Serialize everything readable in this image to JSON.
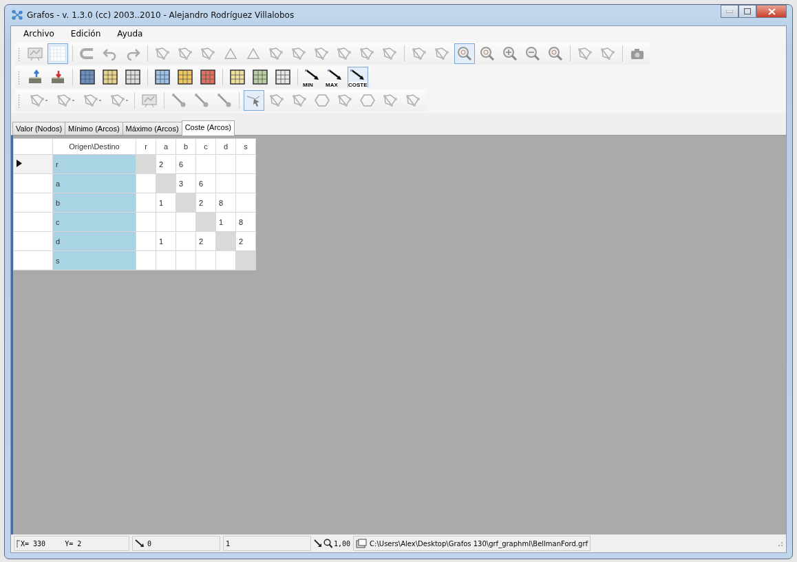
{
  "window": {
    "title": "Grafos - v. 1.3.0  (cc) 2003..2010 - Alejandro Rodríguez Villalobos"
  },
  "menu": [
    "Archivo",
    "Edición",
    "Ayuda"
  ],
  "toolbars": [
    {
      "items": [
        {
          "kind": "board",
          "selected": false
        },
        {
          "kind": "grid",
          "selected": true
        },
        {
          "kind": "separator"
        },
        {
          "kind": "magnet",
          "selected": false
        },
        {
          "kind": "undo",
          "selected": false
        },
        {
          "kind": "redo",
          "selected": false
        },
        {
          "kind": "separator"
        },
        {
          "kind": "graph",
          "selected": false
        },
        {
          "kind": "graph",
          "selected": false
        },
        {
          "kind": "graph",
          "selected": false
        },
        {
          "kind": "triangle",
          "selected": false
        },
        {
          "kind": "triangle",
          "selected": false
        },
        {
          "kind": "graph",
          "selected": false
        },
        {
          "kind": "graph",
          "selected": false
        },
        {
          "kind": "graph",
          "selected": false
        },
        {
          "kind": "graph",
          "selected": false
        },
        {
          "kind": "graph",
          "selected": false
        },
        {
          "kind": "graph",
          "selected": false
        },
        {
          "kind": "separator"
        },
        {
          "kind": "graph",
          "selected": false
        },
        {
          "kind": "graph",
          "selected": false
        },
        {
          "kind": "zoom",
          "selected": true
        },
        {
          "kind": "zoom",
          "selected": false
        },
        {
          "kind": "zoom-in",
          "selected": false
        },
        {
          "kind": "zoom-out",
          "selected": false
        },
        {
          "kind": "zoom",
          "selected": false
        },
        {
          "kind": "separator"
        },
        {
          "kind": "graph",
          "selected": false
        },
        {
          "kind": "graph",
          "selected": false
        },
        {
          "kind": "separator"
        },
        {
          "kind": "camera",
          "selected": false
        }
      ]
    },
    {
      "items": [
        {
          "kind": "tray-up",
          "selected": false
        },
        {
          "kind": "tray-down",
          "selected": false
        },
        {
          "kind": "separator"
        },
        {
          "kind": "table",
          "color": "#6a8fc0",
          "selected": false
        },
        {
          "kind": "table",
          "color": "#e8d48a",
          "selected": false
        },
        {
          "kind": "table",
          "color": "#dcdcdc",
          "selected": false
        },
        {
          "kind": "separator"
        },
        {
          "kind": "table",
          "color": "#9cc2e8",
          "selected": false
        },
        {
          "kind": "table",
          "color": "#f0c860",
          "selected": false
        },
        {
          "kind": "table",
          "color": "#e07060",
          "selected": false
        },
        {
          "kind": "separator"
        },
        {
          "kind": "table",
          "color": "#f0e0a0",
          "selected": false
        },
        {
          "kind": "table",
          "color": "#b8d0a0",
          "selected": false
        },
        {
          "kind": "table",
          "color": "#e8e8e8",
          "selected": false
        },
        {
          "kind": "separator"
        },
        {
          "kind": "arrow",
          "label": "MIN",
          "selected": false
        },
        {
          "kind": "arrow",
          "label": "MAX",
          "selected": false
        },
        {
          "kind": "arrow",
          "label": "COSTE",
          "selected": true
        }
      ]
    },
    {
      "items": [
        {
          "kind": "graph-menu",
          "selected": false
        },
        {
          "kind": "graph-menu",
          "selected": false
        },
        {
          "kind": "graph-menu",
          "selected": false
        },
        {
          "kind": "graph-menu",
          "selected": false
        },
        {
          "kind": "separator"
        },
        {
          "kind": "board",
          "selected": false
        },
        {
          "kind": "separator"
        },
        {
          "kind": "edge",
          "selected": false
        },
        {
          "kind": "edge",
          "selected": false
        },
        {
          "kind": "edge",
          "selected": false
        },
        {
          "kind": "separator"
        },
        {
          "kind": "pointer",
          "selected": true
        },
        {
          "kind": "graph",
          "selected": false
        },
        {
          "kind": "graph",
          "selected": false
        },
        {
          "kind": "hexagon",
          "selected": false
        },
        {
          "kind": "graph",
          "selected": false
        },
        {
          "kind": "hexagon",
          "selected": false
        },
        {
          "kind": "graph",
          "selected": false
        },
        {
          "kind": "graph",
          "selected": false
        }
      ]
    }
  ],
  "tabs": [
    {
      "label": "Valor (Nodos)",
      "selected": false
    },
    {
      "label": "Mínimo (Arcos)",
      "selected": false
    },
    {
      "label": "Máximo (Arcos)",
      "selected": false
    },
    {
      "label": "Coste (Arcos)",
      "selected": true
    }
  ],
  "table": {
    "columns": [
      "Origen\\Destino",
      "r",
      "a",
      "b",
      "c",
      "d",
      "s"
    ],
    "rows": [
      {
        "selected": true,
        "cells": [
          {
            "text": "r"
          },
          {
            "disabled": true
          },
          {
            "text": "2",
            "disabled": false
          },
          {
            "text": "6",
            "disabled": false
          },
          {
            "disabled": false
          },
          {
            "disabled": false
          },
          {
            "disabled": false
          }
        ]
      },
      {
        "selected": false,
        "cells": [
          {
            "text": "a"
          },
          {
            "disabled": false
          },
          {
            "disabled": true
          },
          {
            "text": "3",
            "disabled": false
          },
          {
            "text": "6",
            "disabled": false
          },
          {
            "disabled": false
          },
          {
            "disabled": false
          }
        ]
      },
      {
        "selected": false,
        "cells": [
          {
            "text": "b"
          },
          {
            "disabled": false
          },
          {
            "text": "1",
            "disabled": false
          },
          {
            "disabled": true
          },
          {
            "text": "2",
            "disabled": false
          },
          {
            "text": "8",
            "disabled": false
          },
          {
            "disabled": false
          }
        ]
      },
      {
        "selected": false,
        "cells": [
          {
            "text": "c"
          },
          {
            "disabled": false
          },
          {
            "disabled": false
          },
          {
            "disabled": false
          },
          {
            "disabled": true
          },
          {
            "text": "1",
            "disabled": false
          },
          {
            "text": "8",
            "disabled": false
          }
        ]
      },
      {
        "selected": false,
        "cells": [
          {
            "text": "d"
          },
          {
            "disabled": false
          },
          {
            "text": "1",
            "disabled": false
          },
          {
            "disabled": false
          },
          {
            "text": "2",
            "disabled": false
          },
          {
            "disabled": true
          },
          {
            "text": "2",
            "disabled": false
          }
        ]
      },
      {
        "selected": false,
        "cells": [
          {
            "text": "s"
          },
          {
            "disabled": false
          },
          {
            "disabled": false
          },
          {
            "disabled": false
          },
          {
            "disabled": false
          },
          {
            "disabled": false
          },
          {
            "disabled": true
          }
        ]
      }
    ]
  },
  "status_bar": {
    "x": "X= 330",
    "y": "Y= 2",
    "edge_value": "0",
    "field": "1",
    "zoom": "1,00",
    "path": "C:\\Users\\Alex\\Desktop\\Grafos 130\\grf_graphml\\BellmanFord.grf"
  }
}
